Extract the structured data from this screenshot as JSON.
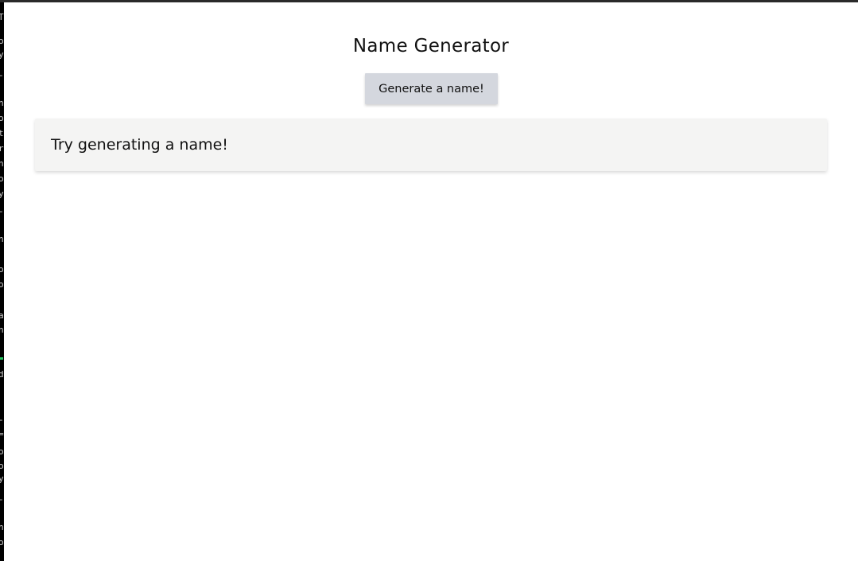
{
  "app": {
    "title": "Name Generator",
    "generate_button_label": "Generate a name!",
    "result_text": "Try generating a name!"
  },
  "background_terminal": {
    "visible_glyphs": [
      "T",
      "o",
      "y",
      "-",
      "n",
      "o",
      "t",
      "r",
      "n",
      "o",
      "y",
      "-",
      "n",
      "o",
      "o",
      "a",
      "n",
      "d",
      "-",
      "=",
      "o",
      "o",
      "y",
      "-",
      "n",
      "o"
    ]
  },
  "colors": {
    "window_background": "#ffffff",
    "button_background": "#d4d7de",
    "card_background": "#f4f4f3",
    "text": "#111111",
    "terminal_accent": "#22c55e"
  }
}
